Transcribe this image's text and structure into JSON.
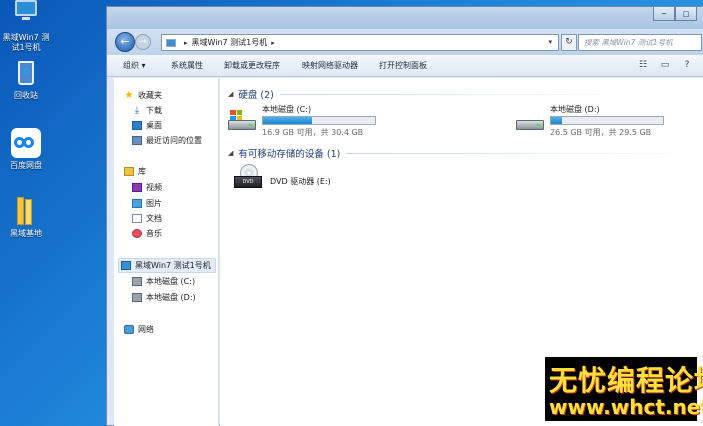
{
  "desktop": {
    "icons": [
      {
        "label": "黑域Win7 测试1号机",
        "icon": "computer-icon"
      },
      {
        "label": "回收站",
        "icon": "recycle-bin-icon"
      },
      {
        "label": "百度网盘",
        "icon": "baidu-netdisk-icon"
      },
      {
        "label": "黑域基地",
        "icon": "folder-icon"
      }
    ]
  },
  "window": {
    "controls": [
      "─",
      "□"
    ],
    "address": {
      "root_sep": "▸",
      "computer": "黑域Win7 测试1号机",
      "trail_sep": "▸",
      "dropdown": "▾"
    },
    "refresh": "↻",
    "search_placeholder": "搜索 黑域Win7 测试1号机",
    "toolbar": {
      "organize": "组织 ▾",
      "system_properties": "系统属性",
      "uninstall": "卸载或更改程序",
      "map_drive": "映射网络驱动器",
      "control_panel": "打开控制面板"
    },
    "nav": {
      "favorites": "收藏夹",
      "downloads": "下载",
      "desktop": "桌面",
      "recent": "最近访问的位置",
      "libraries": "库",
      "videos": "视频",
      "pictures": "图片",
      "documents": "文档",
      "music": "音乐",
      "computer": "黑域Win7 测试1号机",
      "drive_c": "本地磁盘 (C:)",
      "drive_d": "本地磁盘 (D:)",
      "network": "网络"
    },
    "content": {
      "hdd_group": "硬盘 (2)",
      "removable_group": "有可移动存储的设备 (1)",
      "drives": [
        {
          "name": "本地磁盘 (C:)",
          "free_text": "16.9 GB 可用，共 30.4 GB",
          "used_fraction": 0.44
        },
        {
          "name": "本地磁盘 (D:)",
          "free_text": "26.5 GB 可用，共 29.5 GB",
          "used_fraction": 0.1
        }
      ],
      "dvd": {
        "name": "DVD 驱动器 (E:)",
        "badge": "DVD"
      }
    }
  },
  "watermark": {
    "line1": "无忧编程论坛",
    "line2": "www.whct.net"
  },
  "colors": {
    "accent": "#1f86cf",
    "group_heading": "#1e3e78",
    "watermark": "#ffe13a"
  }
}
